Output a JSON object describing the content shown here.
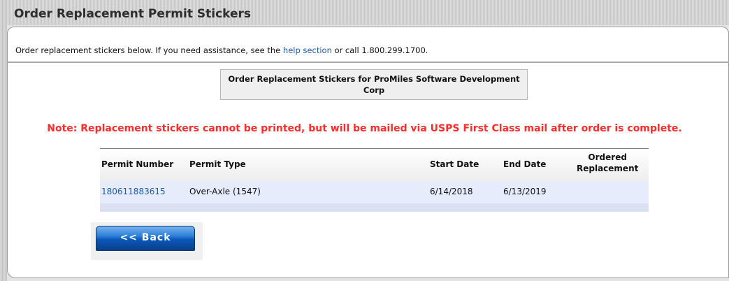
{
  "page": {
    "title": "Order Replacement Permit Stickers"
  },
  "instructions": {
    "prefix": "Order replacement stickers below. If you need assistance, see the ",
    "link_text": "help section",
    "suffix": " or call 1.800.299.1700."
  },
  "company_heading": {
    "line1": "Order Replacement Stickers for ProMiles Software Development",
    "line2": "Corp"
  },
  "note": "Note: Replacement stickers cannot be printed, but will be mailed via USPS First Class mail after order is complete.",
  "table": {
    "headers": {
      "permit_number": "Permit Number",
      "permit_type": "Permit Type",
      "start_date": "Start Date",
      "end_date": "End Date",
      "ordered_replacement_1": "Ordered",
      "ordered_replacement_2": "Replacement"
    },
    "rows": [
      {
        "permit_number": "180611883615",
        "permit_type": "Over-Axle (1547)",
        "start_date": "6/14/2018",
        "end_date": "6/13/2019",
        "ordered_replacement": ""
      }
    ]
  },
  "buttons": {
    "back_label": "<< Back"
  },
  "colors": {
    "note_red": "#ff2a2a",
    "link_blue": "#1f5bab",
    "row_background": "#e6ecfb",
    "button_blue": "#0a58b8"
  }
}
